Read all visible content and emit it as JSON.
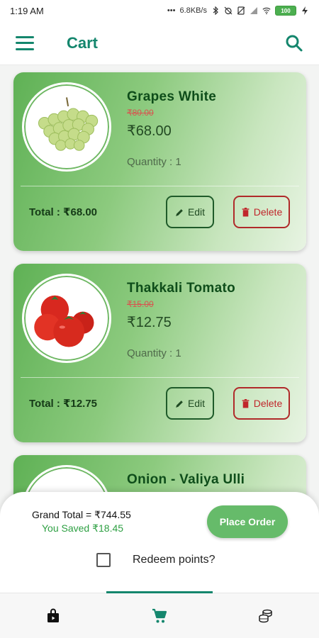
{
  "status_bar": {
    "time": "1:19 AM",
    "net_speed": "6.8KB/s",
    "battery": "100"
  },
  "app_bar": {
    "title": "Cart",
    "menu_icon": "menu-icon",
    "search_icon": "search-icon"
  },
  "items": [
    {
      "name": "Grapes White",
      "old_price": "₹80.00",
      "price": "₹68.00",
      "quantity": "Quantity : 1",
      "total": "Total : ₹68.00",
      "edit_label": "Edit",
      "delete_label": "Delete",
      "image": "grapes"
    },
    {
      "name": "Thakkali Tomato",
      "old_price": "₹15.00",
      "price": "₹12.75",
      "quantity": "Quantity : 1",
      "total": "Total : ₹12.75",
      "edit_label": "Edit",
      "delete_label": "Delete",
      "image": "tomato"
    },
    {
      "name": "Onion - Valiya Ulli",
      "image": "onion"
    }
  ],
  "summary": {
    "grand_total": "Grand Total = ₹744.55",
    "saved": "You Saved ₹18.45",
    "place_order": "Place Order",
    "redeem_label": "Redeem points?",
    "redeem_checked": false
  },
  "bottom_nav": {
    "items": [
      {
        "icon": "shopping-bag-icon",
        "active": false
      },
      {
        "icon": "cart-icon",
        "active": true
      },
      {
        "icon": "coins-icon",
        "active": false
      }
    ]
  },
  "colors": {
    "primary": "#14866d",
    "accent_green": "#66bb6a",
    "delete_red": "#c0262b"
  }
}
